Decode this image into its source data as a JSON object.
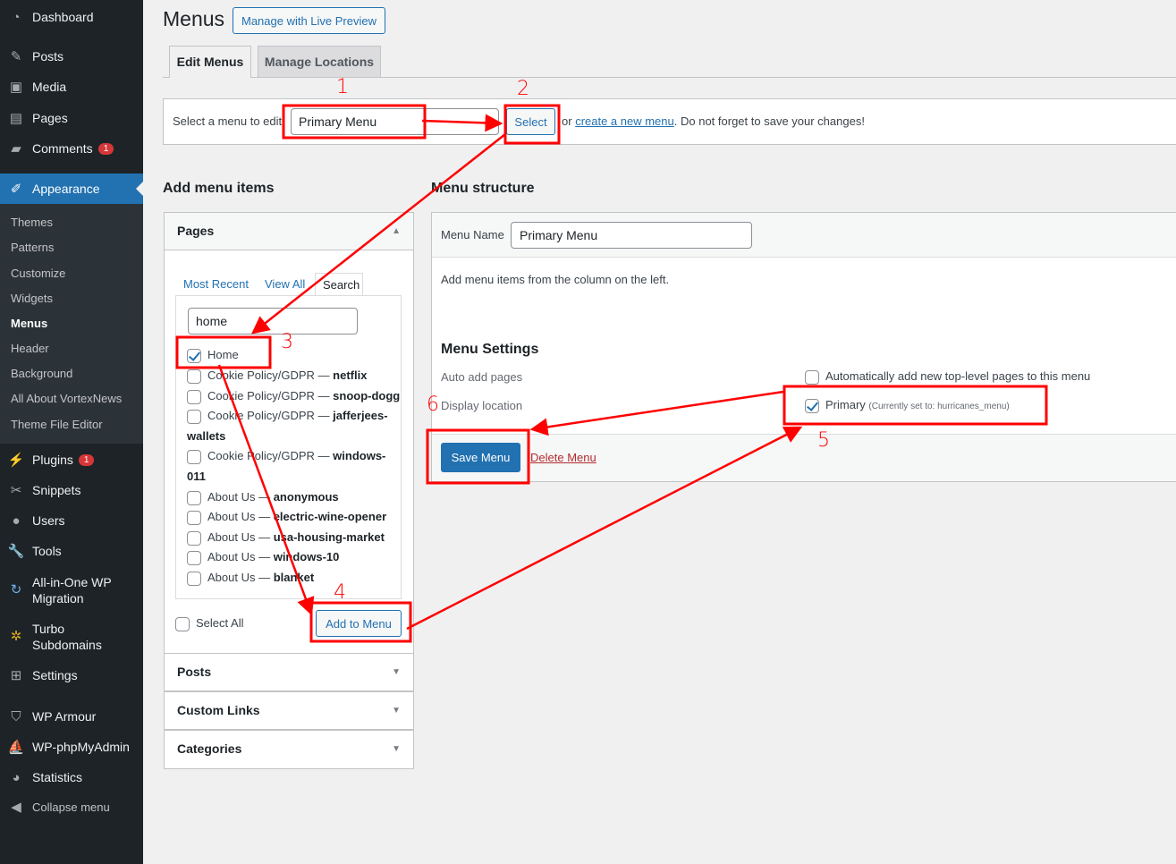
{
  "sidebar": {
    "items": [
      {
        "label": "Dashboard",
        "icon": "dashboard-icon"
      },
      {
        "label": "Posts",
        "icon": "pin-icon"
      },
      {
        "label": "Media",
        "icon": "media-icon"
      },
      {
        "label": "Pages",
        "icon": "pages-icon"
      },
      {
        "label": "Comments",
        "icon": "comment-icon",
        "badge": "1"
      },
      {
        "label": "Appearance",
        "icon": "brush-icon",
        "active": true
      },
      {
        "label": "Plugins",
        "icon": "plugin-icon",
        "badge": "1"
      },
      {
        "label": "Snippets",
        "icon": "scissors-icon"
      },
      {
        "label": "Users",
        "icon": "user-icon"
      },
      {
        "label": "Tools",
        "icon": "wrench-icon"
      },
      {
        "label": "All-in-One WP Migration",
        "icon": "migration-icon"
      },
      {
        "label": "Turbo Subdomains",
        "icon": "gear-cluster-icon"
      },
      {
        "label": "Settings",
        "icon": "settings-icon"
      },
      {
        "label": "WP Armour",
        "icon": "shield-icon"
      },
      {
        "label": "WP-phpMyAdmin",
        "icon": "phpmyadmin-icon"
      },
      {
        "label": "Statistics",
        "icon": "pie-icon"
      },
      {
        "label": "Collapse menu",
        "icon": "collapse-icon"
      }
    ],
    "submenu": [
      "Themes",
      "Patterns",
      "Customize",
      "Widgets",
      "Menus",
      "Header",
      "Background",
      "All About VortexNews",
      "Theme File Editor"
    ],
    "active_submenu": "Menus"
  },
  "header": {
    "title": "Menus",
    "live_preview": "Manage with Live Preview"
  },
  "tabs": [
    {
      "label": "Edit Menus",
      "active": true
    },
    {
      "label": "Manage Locations"
    }
  ],
  "select_bar": {
    "label": "Select a menu to edit:",
    "value": "Primary Menu",
    "select_button": "Select",
    "or": "or",
    "create_link": "create a new menu",
    "suffix": ". Do not forget to save your changes!"
  },
  "add_items": {
    "heading": "Add menu items",
    "pages_title": "Pages",
    "tabs": [
      "Most Recent",
      "View All",
      "Search"
    ],
    "search_value": "home",
    "results": [
      {
        "prefix": "Home",
        "bold": "",
        "checked": true
      },
      {
        "prefix": "Cookie Policy/GDPR — ",
        "bold": "netflix"
      },
      {
        "prefix": "Cookie Policy/GDPR — ",
        "bold": "snoop-dogg"
      },
      {
        "prefix": "Cookie Policy/GDPR — ",
        "bold": "jafferjees-",
        "cont": "wallets"
      },
      {
        "prefix": "Cookie Policy/GDPR — ",
        "bold": "windows-",
        "cont": "011"
      },
      {
        "prefix": "About Us — ",
        "bold": "anonymous"
      },
      {
        "prefix": "About Us — ",
        "bold": "electric-wine-opener"
      },
      {
        "prefix": "About Us — ",
        "bold": "usa-housing-market"
      },
      {
        "prefix": "About Us — ",
        "bold": "windows-10"
      },
      {
        "prefix": "About Us — ",
        "bold": "blanket"
      }
    ],
    "select_all": "Select All",
    "add_button": "Add to Menu",
    "sections": [
      "Posts",
      "Custom Links",
      "Categories"
    ]
  },
  "structure": {
    "heading": "Menu structure",
    "name_label": "Menu Name",
    "name_value": "Primary Menu",
    "instructions": "Add menu items from the column on the left.",
    "settings_title": "Menu Settings",
    "auto_add_label": "Auto add pages",
    "auto_add_text": "Automatically add new top-level pages to this menu",
    "auto_add_checked": false,
    "display_label": "Display location",
    "primary_label": "Primary",
    "currently_set": "(Currently set to: ",
    "currently_value": "hurricanes_menu",
    "currently_close": ")",
    "primary_checked": true,
    "save_button": "Save Menu",
    "delete_link": "Delete Menu"
  },
  "annotations": {
    "numbers": [
      "1",
      "2",
      "3",
      "4",
      "5",
      "6"
    ],
    "color": "#ff0000"
  },
  "colors": {
    "accent": "#2271b1",
    "sidebar": "#1d2327",
    "delete": "#b32d2e"
  }
}
